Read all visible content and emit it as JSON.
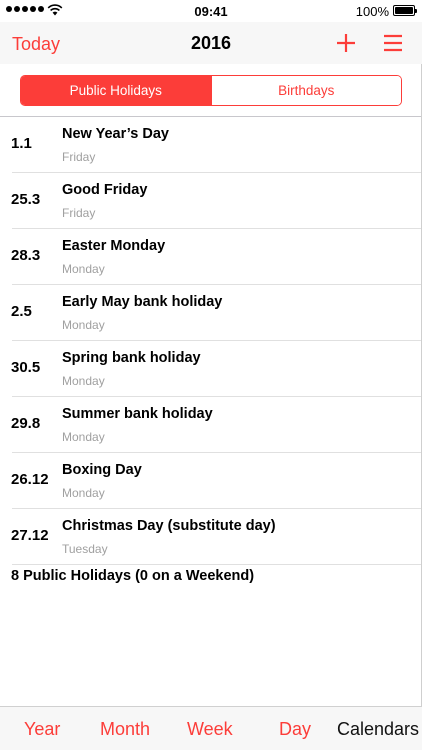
{
  "status": {
    "time": "09:41",
    "battery": "100%"
  },
  "nav": {
    "today_label": "Today",
    "title": "2016"
  },
  "segments": {
    "public_label": "Public Holidays",
    "birthdays_label": "Birthdays"
  },
  "holidays": [
    {
      "date": "1.1",
      "name": "New Year’s Day",
      "day": "Friday"
    },
    {
      "date": "25.3",
      "name": "Good Friday",
      "day": "Friday"
    },
    {
      "date": "28.3",
      "name": "Easter Monday",
      "day": "Monday"
    },
    {
      "date": "2.5",
      "name": "Early May bank holiday",
      "day": "Monday"
    },
    {
      "date": "30.5",
      "name": "Spring bank holiday",
      "day": "Monday"
    },
    {
      "date": "29.8",
      "name": "Summer bank holiday",
      "day": "Monday"
    },
    {
      "date": "26.12",
      "name": "Boxing Day",
      "day": "Monday"
    },
    {
      "date": "27.12",
      "name": "Christmas Day (substitute day)",
      "day": "Tuesday"
    }
  ],
  "summary": "8 Public Holidays (0 on a Weekend)",
  "tabs": {
    "year": "Year",
    "month": "Month",
    "week": "Week",
    "day": "Day",
    "calendars": "Calendars"
  },
  "icons": {
    "plus": "plus-icon",
    "menu": "menu-icon",
    "wifi": "wifi-icon",
    "battery": "battery-icon"
  },
  "colors": {
    "accent": "#fc3d39",
    "text": "#000000",
    "secondary": "#a0a0a0"
  }
}
